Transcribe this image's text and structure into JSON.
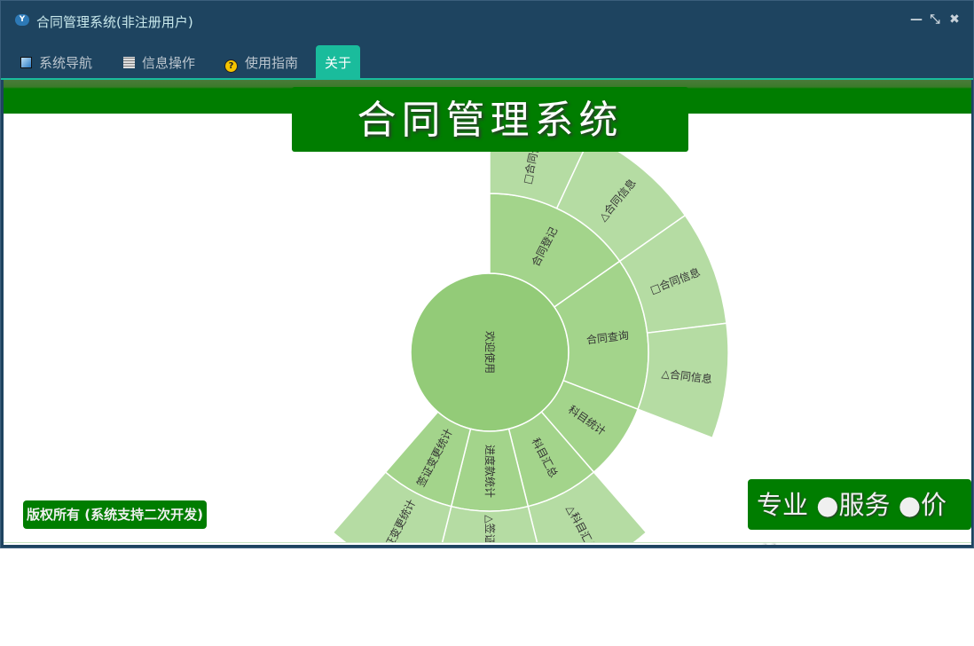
{
  "window": {
    "title": "合同管理系统(非注册用户)",
    "app_icon": "yf-logo-icon",
    "controls": {
      "minimize": "—",
      "restore": "⤡",
      "close": "✖"
    }
  },
  "tabs": [
    {
      "label": "系统导航",
      "icon": "window-icon"
    },
    {
      "label": "信息操作",
      "icon": "grid-icon"
    },
    {
      "label": "使用指南",
      "icon": "help-icon"
    },
    {
      "label": "关于",
      "active": true
    }
  ],
  "banner": {
    "title": "合同管理系统"
  },
  "footer": {
    "copyright": "版权所有 (系统支持二次开发)",
    "slogan": "专业 ●服务 ●价值"
  },
  "colors": {
    "dark": "#1e4460",
    "accent": "#1abc9c",
    "green": "#007d00",
    "center": "#93cb78",
    "ring1": "#a3d48b",
    "ring2": "#b5dca3"
  },
  "chart_data": {
    "type": "sunburst",
    "root": "欢迎使用",
    "children": [
      {
        "name": "合同登记",
        "children": [
          {
            "name": "□合同信息",
            "value": 25
          },
          {
            "name": "△合同信息",
            "value": 30
          }
        ]
      },
      {
        "name": "合同查询",
        "children": [
          {
            "name": "□合同信息",
            "value": 28
          },
          {
            "name": "△合同信息",
            "value": 28
          }
        ]
      },
      {
        "name": "科目统计",
        "value": 28,
        "children": []
      },
      {
        "name": "科目汇总",
        "children": [
          {
            "name": "△科目汇总",
            "value": 27
          }
        ]
      },
      {
        "name": "进度款统计",
        "children": [
          {
            "name": "△签证变更统计",
            "value": 28
          }
        ]
      },
      {
        "name": "签证变更统计",
        "children": [
          {
            "name": "签证变更统计",
            "value": 27
          }
        ]
      }
    ]
  }
}
